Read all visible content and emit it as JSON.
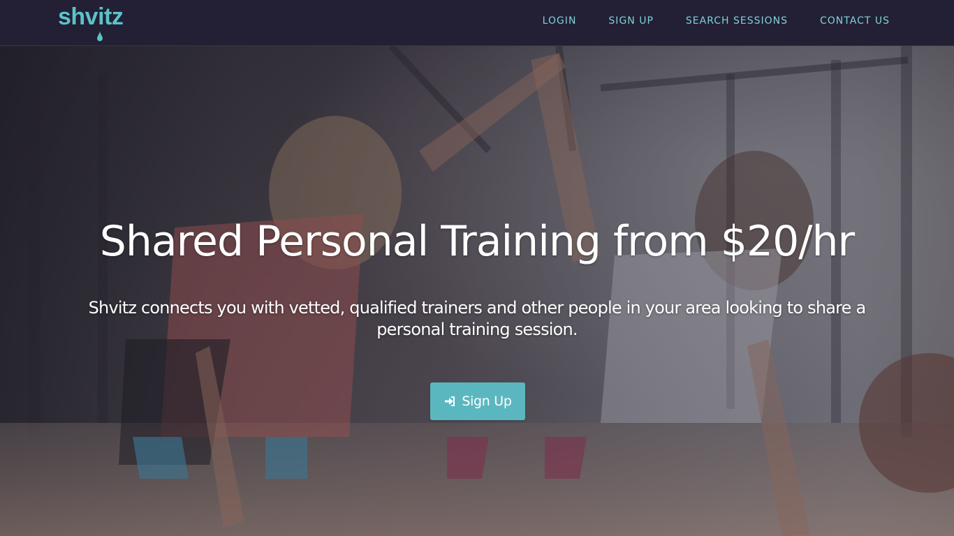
{
  "brand": {
    "name": "shvitz",
    "color": "#5bc3c8"
  },
  "nav": {
    "items": [
      {
        "label": "LOGIN"
      },
      {
        "label": "SIGN UP"
      },
      {
        "label": "SEARCH SESSIONS"
      },
      {
        "label": "CONTACT US"
      }
    ]
  },
  "hero": {
    "title": "Shared Personal Training from $20/hr",
    "subtitle": "Shvitz connects you with vetted, qualified trainers and other people in your area looking to share a personal training session.",
    "cta_label": "Sign Up",
    "cta_icon": "sign-in-icon",
    "cta_color": "#5bb7bf",
    "background_image": "two women doing a high five during plank push-ups in a gym"
  },
  "colors": {
    "navbar_bg": "#231f35",
    "nav_link": "#7fd3d6"
  }
}
